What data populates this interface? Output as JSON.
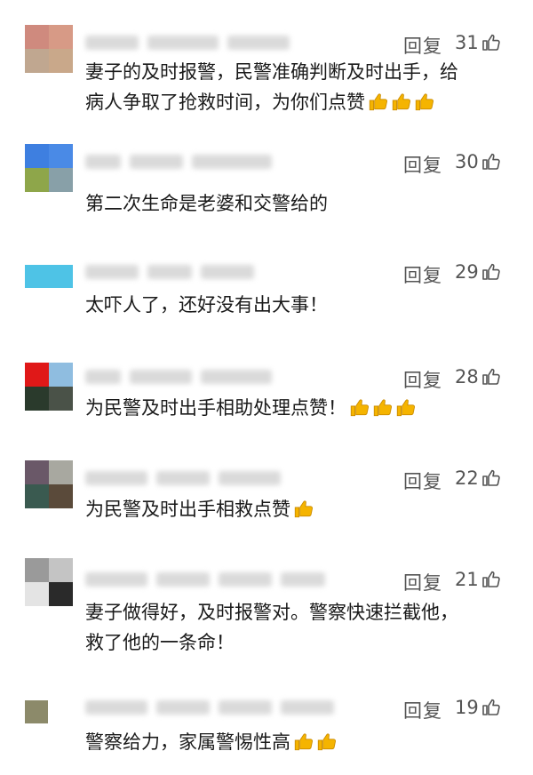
{
  "reply_label": "回复",
  "comments": [
    {
      "likes": "31",
      "text_lines": [
        "妻子的及时报警，民警准确判断及时出手，给",
        "病人争取了抢救时间，为你们点赞"
      ],
      "thumbs": 3
    },
    {
      "likes": "30",
      "text_lines": [
        "第二次生命是老婆和交警给的"
      ],
      "thumbs": 0
    },
    {
      "likes": "29",
      "text_lines": [
        "太吓人了，还好没有出大事！"
      ],
      "thumbs": 0
    },
    {
      "likes": "28",
      "text_lines": [
        "为民警及时出手相助处理点赞！"
      ],
      "thumbs": 3
    },
    {
      "likes": "22",
      "text_lines": [
        "为民警及时出手相救点赞"
      ],
      "thumbs": 1
    },
    {
      "likes": "21",
      "text_lines": [
        "妻子做得好，及时报警对。警察快速拦截他，",
        "救了他的一条命！"
      ],
      "thumbs": 0
    },
    {
      "likes": "19",
      "text_lines": [
        "警察给力，家属警惕性高"
      ],
      "thumbs": 2
    }
  ],
  "colors": {
    "text": "#1a1a1a",
    "meta": "#555555",
    "thumb": "#f5b400"
  }
}
